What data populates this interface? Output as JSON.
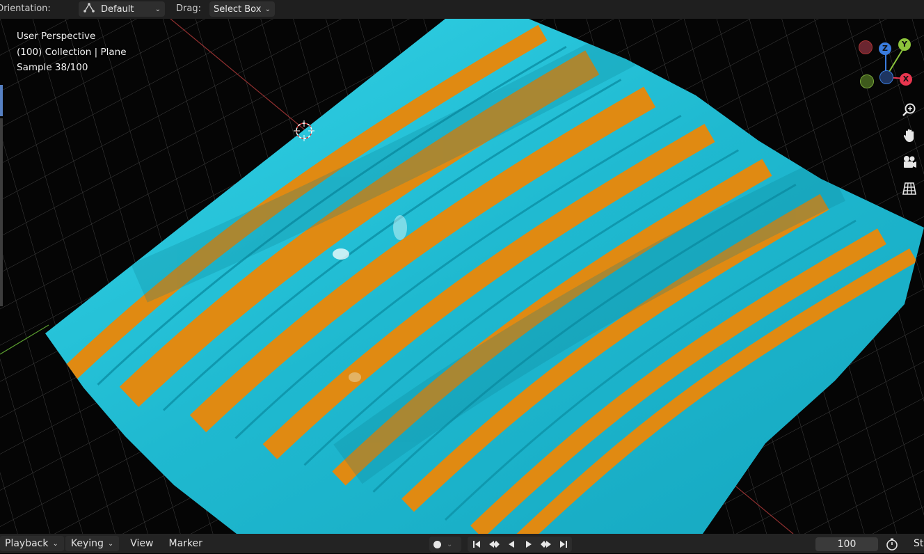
{
  "header": {
    "orientation_label": "Orientation:",
    "orientation_value": "Default",
    "drag_label": "Drag:",
    "drag_value": "Select Box"
  },
  "viewport": {
    "view_name": "User Perspective",
    "collection_line": "(100) Collection | Plane",
    "sample_line": "Sample 38/100"
  },
  "gizmo": {
    "z_label": "Z",
    "y_label": "Y",
    "x_label": "X",
    "colors": {
      "x": "#e8364f",
      "y": "#8cc43b",
      "z": "#3a7cde"
    }
  },
  "nav_icons": [
    "zoom-icon",
    "hand-pan-icon",
    "camera-icon",
    "grid-ortho-icon"
  ],
  "timeline": {
    "playback_label": "Playback",
    "keying_label": "Keying",
    "view_label": "View",
    "marker_label": "Marker",
    "current_frame": "100",
    "start_label_partial": "St"
  },
  "colors": {
    "cyan": "#25c7dc",
    "orange": "#e08a12",
    "background": "#050505"
  }
}
